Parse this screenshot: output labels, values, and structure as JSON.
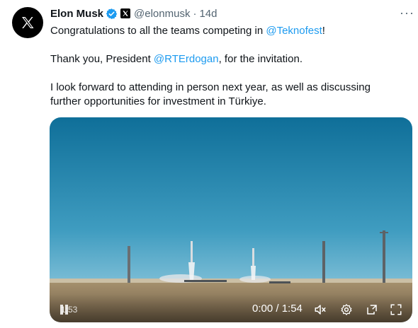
{
  "author": {
    "name": "Elon Musk",
    "handle": "@elonmusk",
    "separator": "·",
    "time": "14d",
    "avatar_icon": "x-logo-icon",
    "verified_icon": "verified-badge-icon",
    "affiliation_icon": "x-affiliate-icon"
  },
  "more_label": "···",
  "tweet": {
    "line1_prefix": "Congratulations to all the teams competing in ",
    "line1_mention": "@Teknofest",
    "line1_suffix": "!",
    "line2_prefix": "Thank you, President ",
    "line2_mention": "@RTErdogan",
    "line2_suffix": ", for the invitation.",
    "line3a": "I look forward to attending in person next year, as well as discussing",
    "line3b": "further opportunities for investment in Türkiye."
  },
  "video": {
    "left_time": "1:53",
    "time_display": "0:00 / 1:54",
    "progress": 0.0,
    "icons": [
      "play-icon",
      "mute-icon",
      "settings-icon",
      "popout-icon",
      "fullscreen-icon"
    ]
  },
  "colors": {
    "link": "#1d9bf0",
    "secondary_text": "#536471",
    "verified": "#1d9bf0",
    "sky": "#1d7fa8",
    "ground": "#b39a74"
  }
}
